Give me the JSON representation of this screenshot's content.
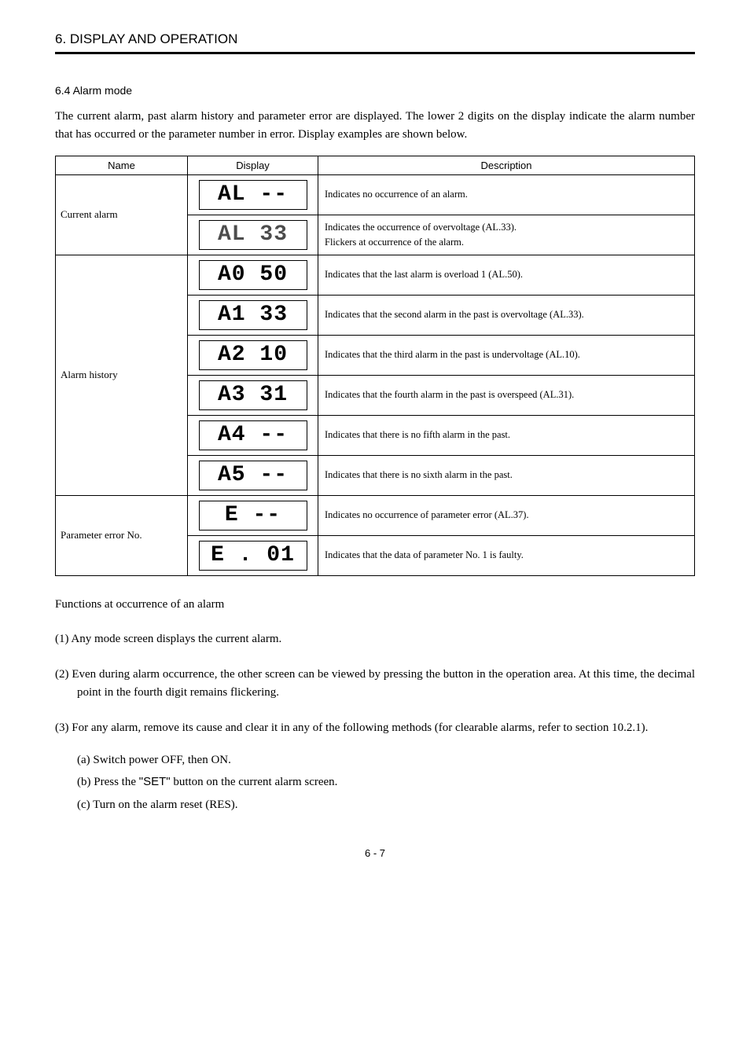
{
  "section_header": "6. DISPLAY AND OPERATION",
  "sub_header": "6.4 Alarm mode",
  "intro": "The current alarm, past alarm history and parameter error are displayed. The lower 2 digits on the display indicate the alarm number that has occurred or the parameter number in error. Display examples are shown below.",
  "table": {
    "headers": {
      "name": "Name",
      "display": "Display",
      "description": "Description"
    },
    "groups": [
      {
        "name": "Current alarm",
        "rows": [
          {
            "display": "AL  --",
            "display_class": "seg-text",
            "desc": "Indicates no occurrence of an alarm."
          },
          {
            "display": "AL  33",
            "display_class": "seg-text seg-dotted",
            "desc": "Indicates the occurrence of overvoltage (AL.33).\nFlickers at occurrence of the alarm."
          }
        ]
      },
      {
        "name": "Alarm history",
        "rows": [
          {
            "display": "A0  50",
            "display_class": "seg-text",
            "desc": "Indicates that the last alarm is overload 1 (AL.50)."
          },
          {
            "display": "A1  33",
            "display_class": "seg-text",
            "desc": "Indicates that the second alarm in the past is overvoltage (AL.33)."
          },
          {
            "display": "A2  10",
            "display_class": "seg-text",
            "desc": "Indicates that the third alarm in the past is undervoltage (AL.10)."
          },
          {
            "display": "A3  31",
            "display_class": "seg-text",
            "desc": "Indicates that the fourth alarm in the past is overspeed (AL.31)."
          },
          {
            "display": "A4  --",
            "display_class": "seg-text",
            "desc": "Indicates that there is no fifth alarm in the past."
          },
          {
            "display": "A5  --",
            "display_class": "seg-text",
            "desc": "Indicates that there is no sixth alarm in the past."
          }
        ]
      },
      {
        "name": "Parameter error No.",
        "rows": [
          {
            "display": "E   --",
            "display_class": "seg-text",
            "desc": "Indicates no occurrence of parameter error (AL.37)."
          },
          {
            "display": "E . 01",
            "display_class": "seg-text",
            "desc": "Indicates that the data of parameter No. 1 is faulty."
          }
        ]
      }
    ]
  },
  "functions_heading": "Functions at occurrence of an alarm",
  "func1": "(1) Any mode screen displays the current alarm.",
  "func2": "(2) Even during alarm occurrence, the other screen can be viewed by pressing the button in the operation area. At this time, the decimal point in the fourth digit remains flickering.",
  "func3": "(3) For any alarm, remove its cause and clear it in any of the following methods (for clearable alarms, refer to section 10.2.1).",
  "sub_a": "(a) Switch power OFF, then ON.",
  "sub_b_pre": "(b) Press the ",
  "sub_b_btn": "\"SET\"",
  "sub_b_post": " button on the current alarm screen.",
  "sub_c": "(c) Turn on the alarm reset (RES).",
  "page_num": "6 -  7"
}
